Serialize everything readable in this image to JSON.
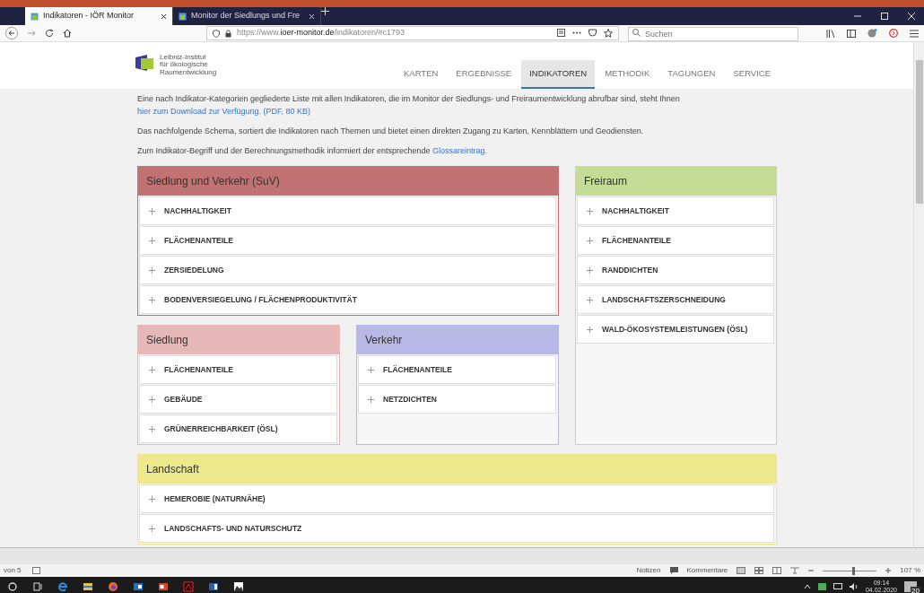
{
  "browser": {
    "tabs": [
      {
        "title": "Indikatoren - IÖR Monitor",
        "selected": true
      },
      {
        "title": "Monitor der Siedlungs und Fre",
        "selected": false
      }
    ],
    "url_prefix": "https://www.",
    "url_domain": "ioer-monitor.de",
    "url_path": "/indikatoren/#c1793",
    "search": {
      "placeholder": "Suchen"
    }
  },
  "site": {
    "logo_text": [
      "Leibniz-Institut",
      "für ökologische",
      "Raumentwicklung"
    ],
    "nav": [
      {
        "label": "KARTEN",
        "selected": false
      },
      {
        "label": "ERGEBNISSE",
        "selected": false
      },
      {
        "label": "INDIKATOREN",
        "selected": true
      },
      {
        "label": "METHODIK",
        "selected": false
      },
      {
        "label": "TAGUNGEN",
        "selected": false
      },
      {
        "label": "SERVICE",
        "selected": false
      }
    ],
    "paragraphs": [
      {
        "text": "Eine nach Indikator-Kategorien gegliederte Liste mit allen Indikatoren, die im Monitor der Siedlungs- und Freiraumentwicklung abrufbar sind, steht Ihnen ",
        "link": "hier zum Download zur Verfügung. (PDF, 80 KB)"
      },
      {
        "text": "Das nachfolgende Schema, sortiert die Indikatoren nach Themen und bietet einen direkten Zugang zu Karten, Kennblättern und Geodiensten."
      },
      {
        "text": "Zum Indikator-Begriff und der Berechnungsmethodik informiert der entsprechende ",
        "link": "Glossareintrag",
        "after": "."
      }
    ],
    "panels": [
      {
        "title": "Siedlung und Verkehr (SuV)",
        "color": "#c07372",
        "items": [
          "NACHHALTIGKEIT",
          "FLÄCHENANTEILE",
          "ZERSIEDELUNG",
          "BODENVERSIEGELUNG / FLÄCHENPRODUKTIVITÄT"
        ]
      },
      {
        "title": "Freiraum",
        "color": "#c5dc97",
        "items": [
          "NACHHALTIGKEIT",
          "FLÄCHENANTEILE",
          "RANDDICHTEN",
          "LANDSCHAFTSZERSCHNEIDUNG",
          "WALD-ÖKOSYSTEMLEISTUNGEN (ÖSL)"
        ]
      },
      {
        "title": "Siedlung",
        "color": "#e8b7b8",
        "items": [
          "FLÄCHENANTEILE",
          "GEBÄUDE",
          "GRÜNERREICHBARKEIT (ÖSL)"
        ]
      },
      {
        "title": "Verkehr",
        "color": "#b8b8e6",
        "items": [
          "FLÄCHENANTEILE",
          "NETZDICHTEN"
        ]
      },
      {
        "title": "Landschaft",
        "color": "#ede88c",
        "items": [
          "HEMEROBIE (NATURNÄHE)",
          "LANDSCHAFTS- UND NATURSCHUTZ"
        ]
      }
    ]
  },
  "ppt_status": {
    "slide": "von 5",
    "notes": "Notizen",
    "comments": "Kommentare",
    "zoom": "107 %",
    "zoom_slider": {
      "level": 0.55
    }
  },
  "taskbar": {
    "time": "09:14",
    "date": "04.02.2020",
    "notifications": "20"
  }
}
